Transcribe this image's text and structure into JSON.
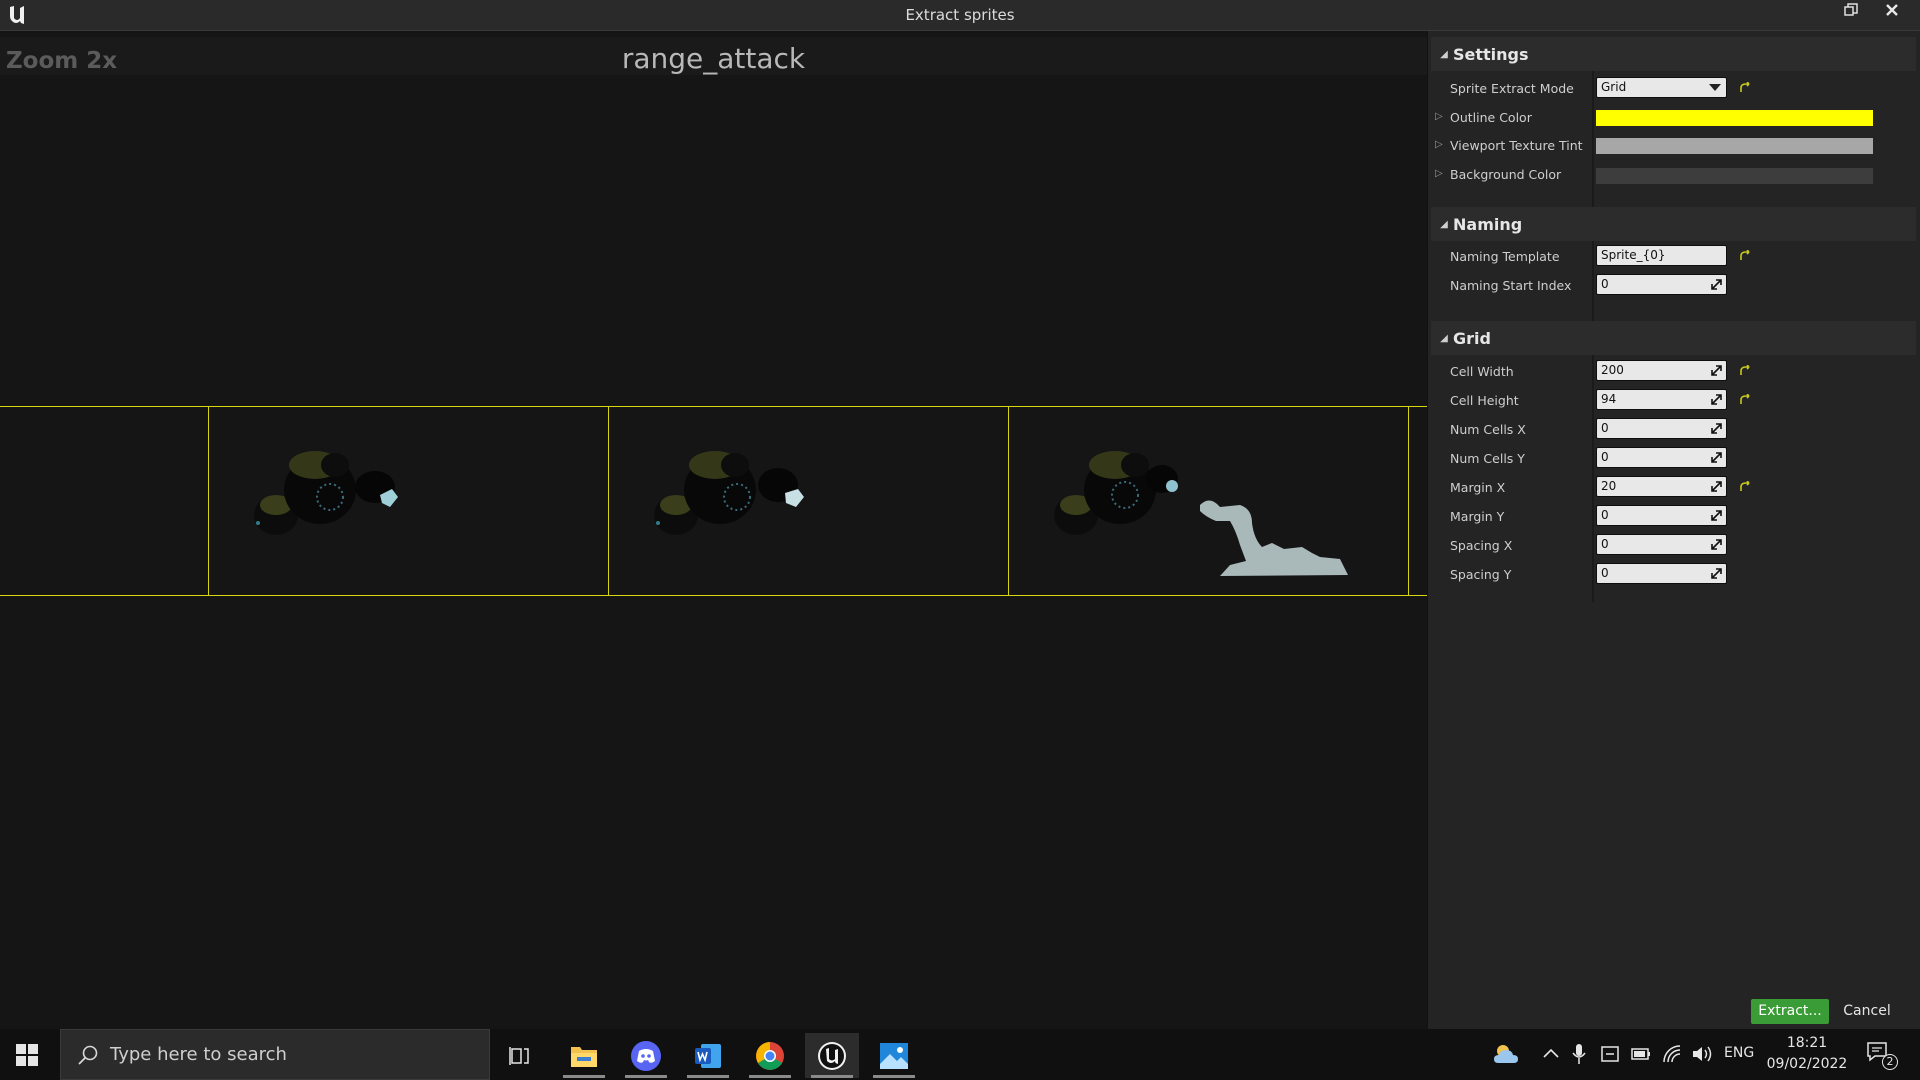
{
  "window": {
    "title": "Extract sprites",
    "restore_icon": "restore-icon",
    "close_icon": "close-icon"
  },
  "viewport": {
    "zoom_label": "Zoom 2x",
    "texture_name": "range_attack",
    "outline_color": "#d7d711"
  },
  "settings": {
    "header": "Settings",
    "sprite_extract_mode": {
      "label": "Sprite Extract Mode",
      "value": "Grid"
    },
    "outline_color": {
      "label": "Outline Color",
      "color": "#ffff00"
    },
    "viewport_texture_tint": {
      "label": "Viewport Texture Tint",
      "color": "#a7a7a7"
    },
    "background_color": {
      "label": "Background Color",
      "color": "#3d3d3d"
    }
  },
  "naming": {
    "header": "Naming",
    "naming_template": {
      "label": "Naming Template",
      "value": "Sprite_{0}"
    },
    "naming_start_index": {
      "label": "Naming Start Index",
      "value": "0"
    }
  },
  "grid": {
    "header": "Grid",
    "cell_width": {
      "label": "Cell Width",
      "value": "200"
    },
    "cell_height": {
      "label": "Cell Height",
      "value": "94"
    },
    "num_cells_x": {
      "label": "Num Cells X",
      "value": "0"
    },
    "num_cells_y": {
      "label": "Num Cells Y",
      "value": "0"
    },
    "margin_x": {
      "label": "Margin X",
      "value": "20"
    },
    "margin_y": {
      "label": "Margin Y",
      "value": "0"
    },
    "spacing_x": {
      "label": "Spacing X",
      "value": "0"
    },
    "spacing_y": {
      "label": "Spacing Y",
      "value": "0"
    }
  },
  "buttons": {
    "extract": "Extract...",
    "cancel": "Cancel"
  },
  "taskbar": {
    "search_placeholder": "Type here to search",
    "apps": [
      "task-view-icon",
      "file-explorer-icon",
      "discord-icon",
      "word-icon",
      "chrome-icon",
      "unreal-engine-icon",
      "photos-icon"
    ],
    "language": "ENG",
    "time": "18:21",
    "date": "09/02/2022",
    "notifications": "2"
  }
}
